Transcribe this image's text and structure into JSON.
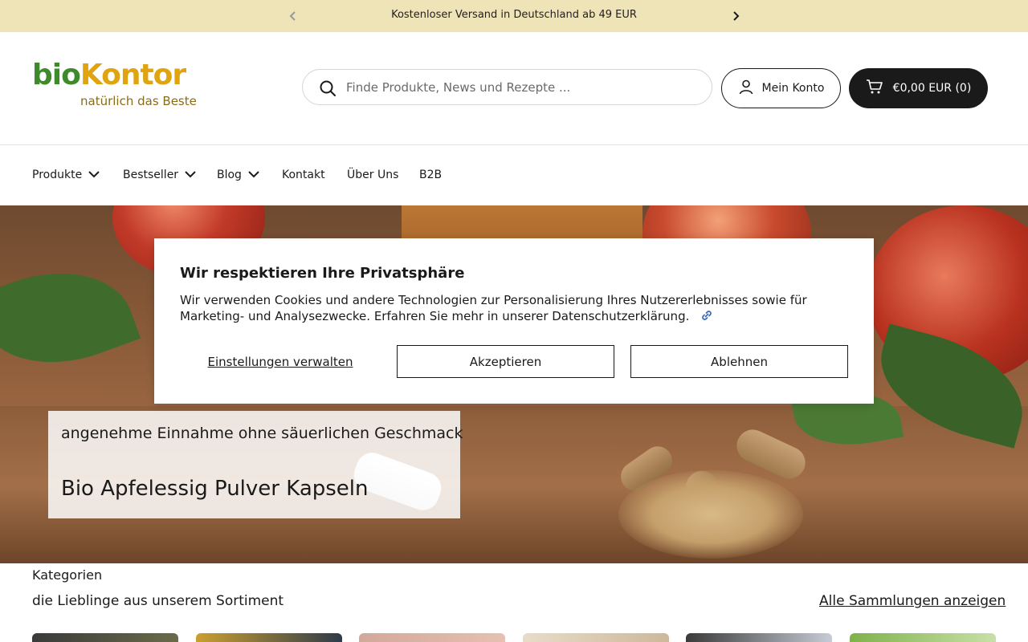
{
  "announcement": {
    "text": "Kostenloser Versand in Deutschland ab 49 EUR",
    "prev_icon": "chevron-left-icon",
    "next_icon": "chevron-right-icon"
  },
  "header": {
    "logo": {
      "part1": "bio",
      "part2": "Kontor",
      "tagline": "natürlich das Beste"
    },
    "search": {
      "placeholder": "Finde Produkte, News und Rezepte ...",
      "icon": "search-icon"
    },
    "account": {
      "label": "Mein Konto",
      "icon": "user-icon"
    },
    "cart": {
      "label": "€0,00 EUR (0)",
      "icon": "cart-icon"
    }
  },
  "nav": {
    "items": [
      {
        "label": "Produkte",
        "has_dropdown": true
      },
      {
        "label": "Bestseller",
        "has_dropdown": true
      },
      {
        "label": "Blog",
        "has_dropdown": true
      },
      {
        "label": "Kontakt",
        "has_dropdown": false
      },
      {
        "label": "Über Uns",
        "has_dropdown": false
      },
      {
        "label": "B2B",
        "has_dropdown": false
      }
    ]
  },
  "hero": {
    "subtitle": "angenehme Einnahme ohne säuerlichen Geschmack",
    "title": "Bio Apfelessig Pulver Kapseln"
  },
  "cookie": {
    "title": "Wir respektieren Ihre Privatsphäre",
    "body": "Wir verwenden Cookies und andere Technologien zur Personalisierung Ihres Nutzererlebnisses sowie für Marketing- und Analysezwecke. Erfahren Sie mehr in unserer Datenschutzerklärung.",
    "link_icon": "link-icon",
    "manage_label": "Einstellungen verwalten",
    "accept_label": "Akzeptieren",
    "decline_label": "Ablehnen"
  },
  "categories": {
    "title": "Kategorien",
    "subtitle": "die Lieblinge aus unserem Sortiment",
    "view_all": "Alle Sammlungen anzeigen"
  },
  "colors": {
    "announcement_bg": "#efe3b8",
    "logo_green": "#3f8a2a",
    "logo_orange": "#e0a410",
    "button_dark": "#1a1a1a"
  }
}
